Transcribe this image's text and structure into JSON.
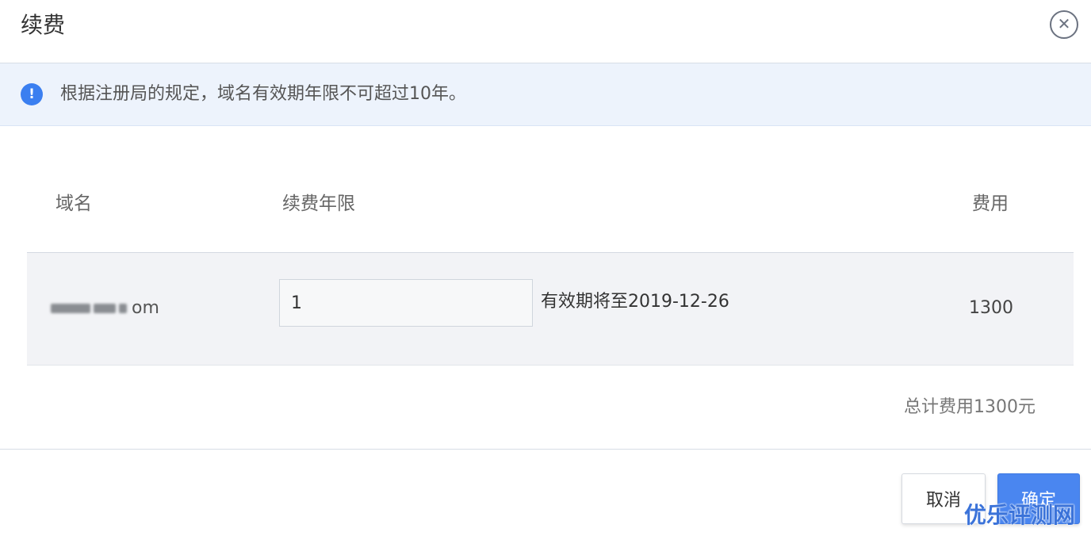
{
  "dialog": {
    "title": "续费",
    "close_icon": "✕"
  },
  "notice": {
    "icon": "!",
    "text": "根据注册局的规定，域名有效期年限不可超过10年。"
  },
  "table": {
    "columns": [
      "域名",
      "续费年限",
      "费用"
    ],
    "rows": [
      {
        "domain_visible_suffix": "om",
        "years_value": "1",
        "expire_text": "有效期将至2019-12-26",
        "fee": "1300"
      }
    ]
  },
  "total": "总计费用1300元",
  "footer": {
    "cancel_label": "取消",
    "ok_label": "确定"
  },
  "watermark": "优乐评测网",
  "colors": {
    "accent": "#4a86f0",
    "info_icon": "#3b7ff0",
    "notice_bg": "#edf3fc",
    "row_bg": "#f2f3f6"
  }
}
